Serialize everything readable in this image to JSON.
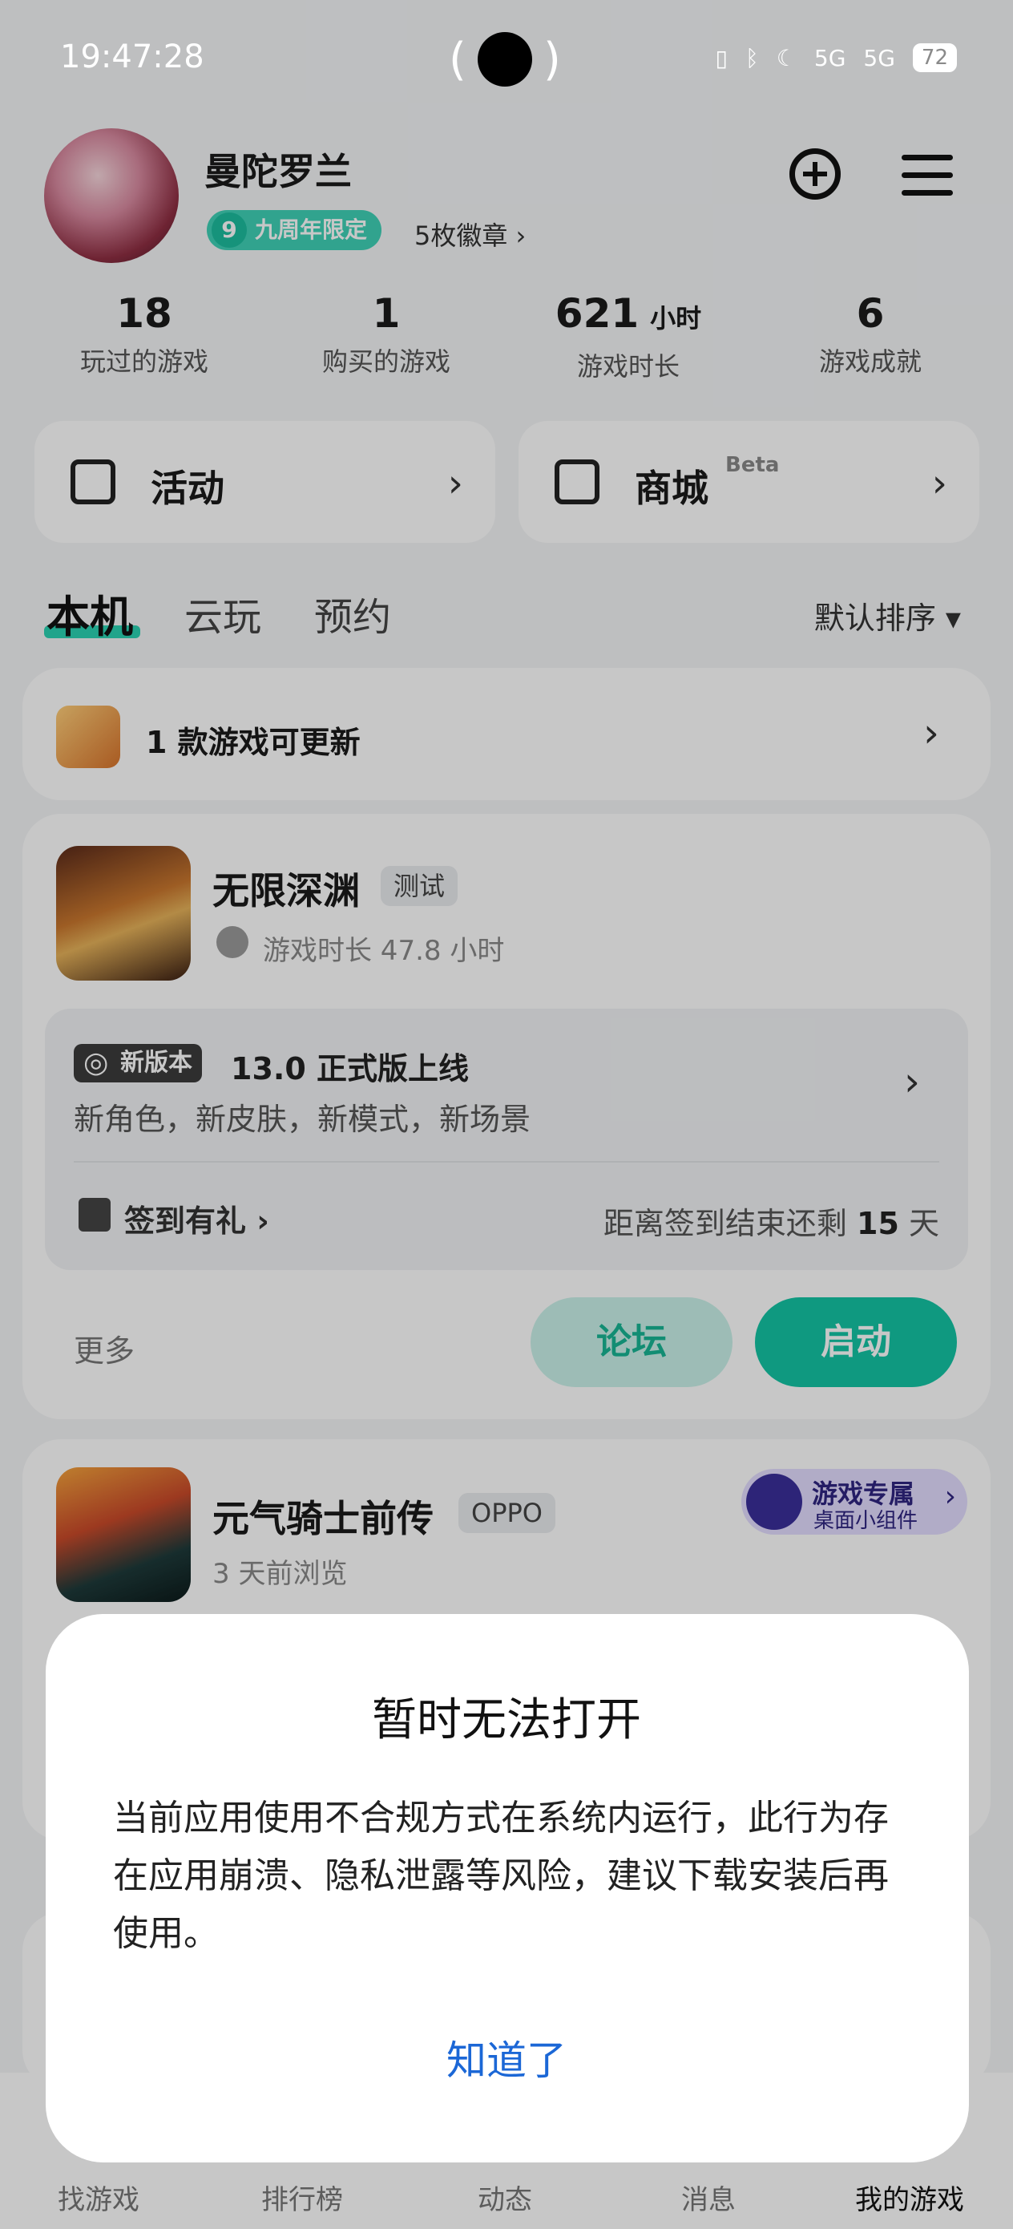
{
  "status_bar": {
    "time": "19:47:28",
    "signal1": "5G",
    "signal2": "5G",
    "battery": "72"
  },
  "profile": {
    "name": "曼陀罗兰",
    "badge_num": "9",
    "badge_label": "九周年限定",
    "medals": "5枚徽章 ›"
  },
  "stats": [
    {
      "value": "18",
      "unit": "",
      "label": "玩过的游戏"
    },
    {
      "value": "1",
      "unit": "",
      "label": "购买的游戏"
    },
    {
      "value": "621",
      "unit": "小时",
      "label": "游戏时长"
    },
    {
      "value": "6",
      "unit": "",
      "label": "游戏成就"
    }
  ],
  "quick": {
    "activity": "活动",
    "store": "商城",
    "store_tag": "Beta"
  },
  "tabs": {
    "local": "本机",
    "cloud": "云玩",
    "reserve": "预约",
    "sort": "默认排序 ▾"
  },
  "update_card": {
    "text": "1 款游戏可更新"
  },
  "game1": {
    "title": "无限深渊",
    "tag": "测试",
    "playtime": "游戏时长 47.8 小时",
    "news_badge": "新版本",
    "news_title": "13.0 正式版上线",
    "news_desc": "新角色，新皮肤，新模式，新场景",
    "checkin": "签到有礼 ›",
    "countdown_prefix": "距离签到结束还剩",
    "countdown_days": "15",
    "countdown_suffix": "天",
    "more": "更多",
    "forum": "论坛",
    "launch": "启动"
  },
  "game2": {
    "title": "元气骑士前传",
    "tag": "OPPO",
    "browse": "3 天前浏览",
    "widget_title": "游戏专属",
    "widget_sub": "桌面小组件"
  },
  "bottom_nav": [
    "找游戏",
    "排行榜",
    "动态",
    "消息",
    "我的游戏"
  ],
  "dialog": {
    "title": "暂时无法打开",
    "body": "当前应用使用不合规方式在系统内运行，此行为存在应用崩溃、隐私泄露等风险，建议下载安装后再使用。",
    "ok": "知道了"
  }
}
